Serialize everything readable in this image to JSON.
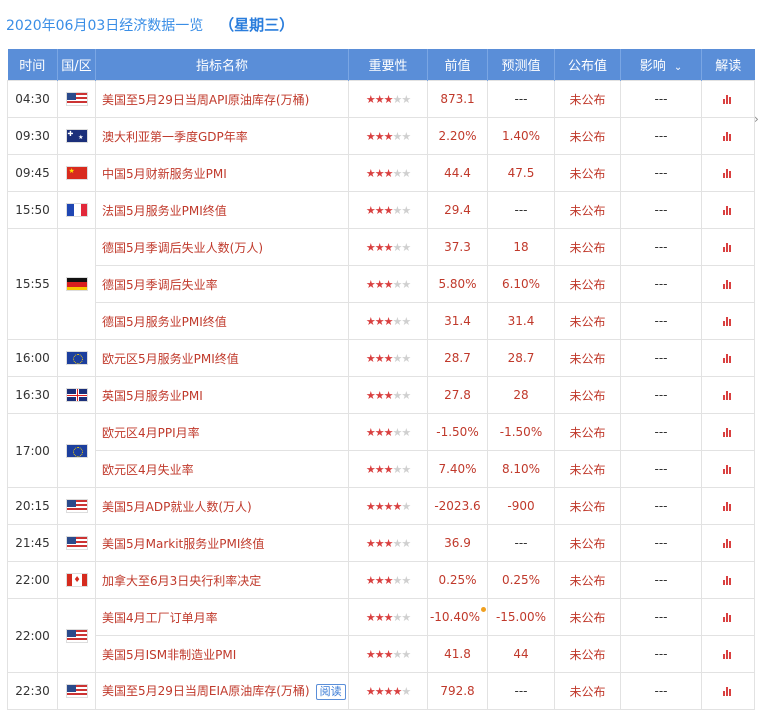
{
  "header": {
    "title": "2020年06月03日经济数据一览",
    "weekday": "（星期三）"
  },
  "columns": [
    "时间",
    "国/区",
    "指标名称",
    "重要性",
    "前值",
    "预测值",
    "公布值",
    "影响",
    "解读"
  ],
  "colors": {
    "header_bg": "#5a8ed8",
    "accent_red": "#c0392b",
    "title_blue": "#3a8ee6"
  },
  "rows": [
    {
      "time": "04:30",
      "flag": "us",
      "name": "美国至5月29日当周API原油库存(万桶)",
      "stars": 3,
      "prev": "873.1",
      "forecast": "---",
      "actual": "未公布",
      "impact": "---",
      "rowspan_time": 1,
      "rowspan_flag": 1
    },
    {
      "time": "09:30",
      "flag": "au",
      "name": "澳大利亚第一季度GDP年率",
      "stars": 3,
      "prev": "2.20%",
      "forecast": "1.40%",
      "actual": "未公布",
      "impact": "---",
      "rowspan_time": 1,
      "rowspan_flag": 1
    },
    {
      "time": "09:45",
      "flag": "cn",
      "name": "中国5月财新服务业PMI",
      "stars": 3,
      "prev": "44.4",
      "forecast": "47.5",
      "actual": "未公布",
      "impact": "---",
      "rowspan_time": 1,
      "rowspan_flag": 1
    },
    {
      "time": "15:50",
      "flag": "fr",
      "name": "法国5月服务业PMI终值",
      "stars": 3,
      "prev": "29.4",
      "forecast": "---",
      "actual": "未公布",
      "impact": "---",
      "rowspan_time": 1,
      "rowspan_flag": 1
    },
    {
      "time": "15:55",
      "flag": "de",
      "name": "德国5月季调后失业人数(万人)",
      "stars": 3,
      "prev": "37.3",
      "forecast": "18",
      "actual": "未公布",
      "impact": "---",
      "rowspan_time": 3,
      "rowspan_flag": 3
    },
    {
      "time": null,
      "flag": null,
      "name": "德国5月季调后失业率",
      "stars": 3,
      "prev": "5.80%",
      "forecast": "6.10%",
      "actual": "未公布",
      "impact": "---"
    },
    {
      "time": null,
      "flag": null,
      "name": "德国5月服务业PMI终值",
      "stars": 3,
      "prev": "31.4",
      "forecast": "31.4",
      "actual": "未公布",
      "impact": "---"
    },
    {
      "time": "16:00",
      "flag": "eu",
      "name": "欧元区5月服务业PMI终值",
      "stars": 3,
      "prev": "28.7",
      "forecast": "28.7",
      "actual": "未公布",
      "impact": "---",
      "rowspan_time": 1,
      "rowspan_flag": 1
    },
    {
      "time": "16:30",
      "flag": "gb",
      "name": "英国5月服务业PMI",
      "stars": 3,
      "prev": "27.8",
      "forecast": "28",
      "actual": "未公布",
      "impact": "---",
      "rowspan_time": 1,
      "rowspan_flag": 1
    },
    {
      "time": "17:00",
      "flag": "eu",
      "name": "欧元区4月PPI月率",
      "stars": 3,
      "prev": "-1.50%",
      "forecast": "-1.50%",
      "actual": "未公布",
      "impact": "---",
      "rowspan_time": 2,
      "rowspan_flag": 2
    },
    {
      "time": null,
      "flag": null,
      "name": "欧元区4月失业率",
      "stars": 3,
      "prev": "7.40%",
      "forecast": "8.10%",
      "actual": "未公布",
      "impact": "---"
    },
    {
      "time": "20:15",
      "flag": "us",
      "name": "美国5月ADP就业人数(万人)",
      "stars": 4,
      "prev": "-2023.6",
      "forecast": "-900",
      "actual": "未公布",
      "impact": "---",
      "rowspan_time": 1,
      "rowspan_flag": 1
    },
    {
      "time": "21:45",
      "flag": "us",
      "name": "美国5月Markit服务业PMI终值",
      "stars": 3,
      "prev": "36.9",
      "forecast": "---",
      "actual": "未公布",
      "impact": "---",
      "rowspan_time": 1,
      "rowspan_flag": 1
    },
    {
      "time": "22:00",
      "flag": "ca",
      "name": "加拿大至6月3日央行利率决定",
      "stars": 3,
      "prev": "0.25%",
      "forecast": "0.25%",
      "actual": "未公布",
      "impact": "---",
      "rowspan_time": 1,
      "rowspan_flag": 1
    },
    {
      "time": "22:00",
      "flag": "us",
      "name": "美国4月工厂订单月率",
      "stars": 3,
      "prev": "-10.40%",
      "prev_dot": true,
      "forecast": "-15.00%",
      "actual": "未公布",
      "impact": "---",
      "rowspan_time": 2,
      "rowspan_flag": 2
    },
    {
      "time": null,
      "flag": null,
      "name": "美国5月ISM非制造业PMI",
      "stars": 3,
      "prev": "41.8",
      "forecast": "44",
      "actual": "未公布",
      "impact": "---"
    },
    {
      "time": "22:30",
      "flag": "us",
      "name": "美国至5月29日当周EIA原油库存(万桶)",
      "stars": 4,
      "prev": "792.8",
      "forecast": "---",
      "actual": "未公布",
      "impact": "---",
      "read_label": "阅读",
      "rowspan_time": 1,
      "rowspan_flag": 1
    }
  ]
}
